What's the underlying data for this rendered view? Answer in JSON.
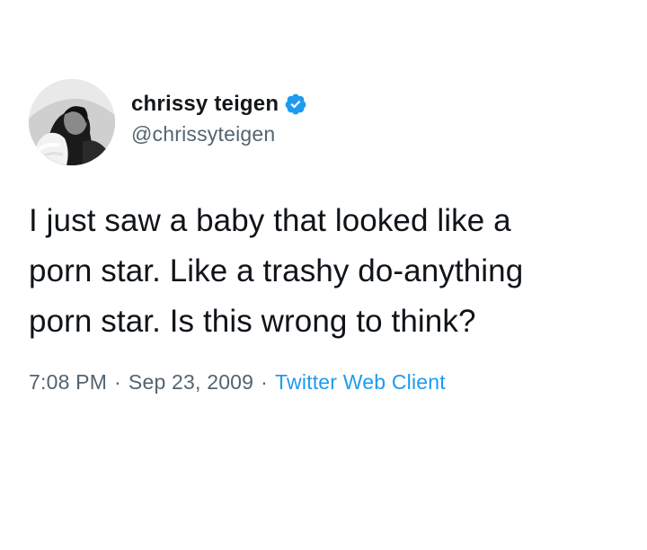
{
  "user": {
    "display_name": "chrissy teigen",
    "handle": "@chrissyteigen",
    "verified": true,
    "avatar_icon": "profile-photo"
  },
  "tweet": {
    "text": "I just saw a baby that looked like a\nporn star. Like a trashy do-anything\nporn star. Is this wrong to think?"
  },
  "meta": {
    "time": "7:08 PM",
    "separator": "·",
    "date": "Sep 23, 2009",
    "source": "Twitter Web Client"
  },
  "colors": {
    "text": "#0f1419",
    "secondary": "#536471",
    "accent": "#1d9bf0",
    "background": "#ffffff"
  }
}
